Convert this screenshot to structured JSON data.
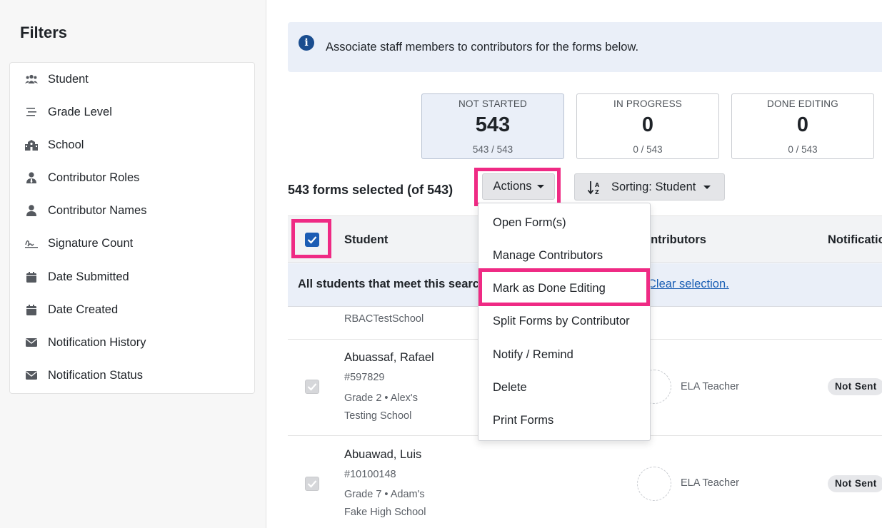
{
  "sidebar": {
    "title": "Filters",
    "items": [
      {
        "label": "Student",
        "icon": "users-icon"
      },
      {
        "label": "Grade Level",
        "icon": "list-icon"
      },
      {
        "label": "School",
        "icon": "school-icon"
      },
      {
        "label": "Contributor Roles",
        "icon": "user-tie-icon"
      },
      {
        "label": "Contributor Names",
        "icon": "user-icon"
      },
      {
        "label": "Signature Count",
        "icon": "signature-icon"
      },
      {
        "label": "Date Submitted",
        "icon": "calendar-icon"
      },
      {
        "label": "Date Created",
        "icon": "calendar-icon"
      },
      {
        "label": "Notification History",
        "icon": "envelope-icon"
      },
      {
        "label": "Notification Status",
        "icon": "envelope-icon"
      }
    ]
  },
  "banner": {
    "icon": "info-icon",
    "text": "Associate staff members to contributors for the forms below."
  },
  "stats": [
    {
      "label": "NOT STARTED",
      "value": "543",
      "sub": "543 / 543",
      "active": true
    },
    {
      "label": "IN PROGRESS",
      "value": "0",
      "sub": "0 / 543",
      "active": false
    },
    {
      "label": "DONE EDITING",
      "value": "0",
      "sub": "0 / 543",
      "active": false
    }
  ],
  "toolbar": {
    "selected_text": "543 forms selected (of 543)",
    "actions_label": "Actions",
    "sort_label": "Sorting: Student"
  },
  "table": {
    "headers": {
      "student": "Student",
      "contributors": "ontributors",
      "notifications": "Notificatio"
    },
    "select_banner_text": "All students that meet this search",
    "clear_selection": "Clear selection."
  },
  "rows": [
    {
      "name": "",
      "lines": [
        "RBACTestSchool"
      ],
      "role": "",
      "badge": ""
    },
    {
      "name": "Abuassaf, Rafael",
      "lines": [
        "#597829",
        "Grade 2 • Alex's",
        "Testing School"
      ],
      "role": "ELA Teacher",
      "badge": "Not Sent"
    },
    {
      "name": "Abuawad, Luis",
      "lines": [
        "#10100148",
        "Grade 7 • Adam's",
        "Fake High School"
      ],
      "role": "ELA Teacher",
      "badge": "Not Sent"
    }
  ],
  "actions_menu": [
    "Open Form(s)",
    "Manage Contributors",
    "Mark as Done Editing",
    "Split Forms by Contributor",
    "Notify / Remind",
    "Delete",
    "Print Forms"
  ],
  "colors": {
    "highlight": "#ef2a84",
    "accent": "#1d5db4",
    "banner_bg": "#eaeff8"
  }
}
